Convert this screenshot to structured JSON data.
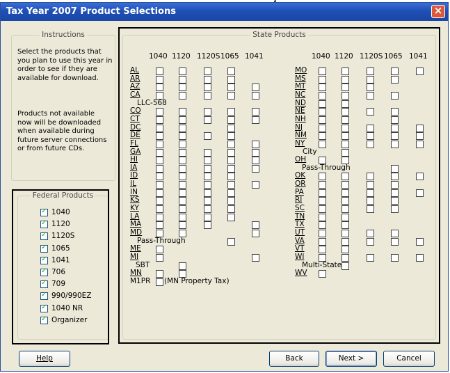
{
  "window": {
    "title": "Tax Year 2007 Product Selections"
  },
  "instructions": {
    "title": "Instructions",
    "para1": [
      "Select the products that",
      "you plan to use this year in",
      "order to see if they are",
      "available for download."
    ],
    "para2": [
      "Products not available",
      "now will be downloaded",
      "when available during",
      "future server connections",
      "or from future CDs."
    ]
  },
  "federal": {
    "title": "Federal Products",
    "items": [
      {
        "label": "1040",
        "checked": true
      },
      {
        "label": "1120",
        "checked": true
      },
      {
        "label": "1120S",
        "checked": true
      },
      {
        "label": "1065",
        "checked": true
      },
      {
        "label": "1041",
        "checked": true
      },
      {
        "label": "706",
        "checked": true
      },
      {
        "label": "709",
        "checked": true
      },
      {
        "label": "990/990EZ",
        "checked": true
      },
      {
        "label": "1040 NR",
        "checked": true
      },
      {
        "label": "Organizer",
        "checked": true
      }
    ]
  },
  "state": {
    "title": "State Products",
    "columns": [
      "1040",
      "1120",
      "1120S",
      "1065",
      "1041"
    ],
    "left": [
      {
        "state": "AL",
        "boxes": [
          1,
          1,
          1,
          1,
          0
        ]
      },
      {
        "state": "AR",
        "boxes": [
          1,
          1,
          1,
          1,
          0
        ]
      },
      {
        "state": "AZ",
        "boxes": [
          1,
          1,
          1,
          1,
          1
        ]
      },
      {
        "state": "CA",
        "boxes": [
          1,
          1,
          1,
          1,
          1
        ]
      },
      {
        "state": "",
        "extra": "LLC-568",
        "boxes": [
          0,
          0,
          0,
          0,
          0
        ]
      },
      {
        "state": "CO",
        "boxes": [
          1,
          1,
          1,
          1,
          1
        ]
      },
      {
        "state": "CT",
        "boxes": [
          1,
          1,
          1,
          1,
          1
        ]
      },
      {
        "state": "DC",
        "boxes": [
          1,
          1,
          0,
          1,
          0
        ]
      },
      {
        "state": "DE",
        "boxes": [
          1,
          1,
          1,
          1,
          0
        ]
      },
      {
        "state": "FL",
        "boxes": [
          1,
          1,
          0,
          1,
          1
        ]
      },
      {
        "state": "GA",
        "boxes": [
          1,
          1,
          1,
          1,
          1
        ]
      },
      {
        "state": "HI",
        "boxes": [
          1,
          1,
          1,
          1,
          1
        ]
      },
      {
        "state": "IA",
        "boxes": [
          1,
          1,
          1,
          1,
          1
        ]
      },
      {
        "state": "ID",
        "boxes": [
          1,
          1,
          1,
          1,
          0
        ]
      },
      {
        "state": "IL",
        "boxes": [
          1,
          1,
          1,
          1,
          1
        ]
      },
      {
        "state": "IN",
        "boxes": [
          1,
          1,
          1,
          1,
          0
        ]
      },
      {
        "state": "KS",
        "boxes": [
          1,
          1,
          1,
          1,
          0
        ]
      },
      {
        "state": "KY",
        "boxes": [
          1,
          1,
          1,
          1,
          0
        ]
      },
      {
        "state": "LA",
        "boxes": [
          1,
          1,
          1,
          1,
          0
        ]
      },
      {
        "state": "MA",
        "boxes": [
          1,
          1,
          1,
          0,
          1
        ]
      },
      {
        "state": "MD",
        "boxes": [
          1,
          1,
          0,
          0,
          1
        ]
      },
      {
        "state": "",
        "extra": "Pass-Through",
        "boxes": [
          0,
          0,
          0,
          1,
          0
        ]
      },
      {
        "state": "ME",
        "boxes": [
          1,
          0,
          0,
          0,
          0
        ]
      },
      {
        "state": "MI",
        "boxes": [
          1,
          0,
          0,
          0,
          1
        ]
      },
      {
        "state": "",
        "extra": "SBT",
        "boxes": [
          0,
          1,
          0,
          0,
          0
        ]
      },
      {
        "state": "MN",
        "boxes": [
          1,
          1,
          0,
          0,
          0
        ]
      },
      {
        "state": "M1PR",
        "plain": true,
        "extra": "(MN Property Tax)",
        "boxes": [
          0,
          0,
          0,
          0,
          0
        ]
      }
    ],
    "right": [
      {
        "state": "MO",
        "boxes": [
          1,
          1,
          1,
          1,
          1
        ]
      },
      {
        "state": "MS",
        "boxes": [
          1,
          1,
          1,
          1,
          0
        ]
      },
      {
        "state": "MT",
        "boxes": [
          1,
          1,
          1,
          0,
          0
        ]
      },
      {
        "state": "NC",
        "boxes": [
          1,
          1,
          1,
          1,
          0
        ]
      },
      {
        "state": "ND",
        "boxes": [
          1,
          1,
          0,
          0,
          0
        ]
      },
      {
        "state": "NE",
        "boxes": [
          1,
          1,
          1,
          1,
          0
        ]
      },
      {
        "state": "NH",
        "boxes": [
          1,
          1,
          0,
          1,
          0
        ]
      },
      {
        "state": "NJ",
        "boxes": [
          1,
          1,
          1,
          1,
          1
        ]
      },
      {
        "state": "NM",
        "boxes": [
          1,
          1,
          1,
          1,
          1
        ]
      },
      {
        "state": "NY",
        "boxes": [
          1,
          1,
          1,
          1,
          1
        ]
      },
      {
        "state": "",
        "extra": "City",
        "boxes": [
          0,
          1,
          0,
          0,
          0
        ]
      },
      {
        "state": "OH",
        "boxes": [
          1,
          1,
          0,
          0,
          0
        ]
      },
      {
        "state": "",
        "extra": "Pass-Through",
        "boxes": [
          0,
          0,
          0,
          1,
          0
        ]
      },
      {
        "state": "OK",
        "boxes": [
          1,
          1,
          1,
          1,
          1
        ]
      },
      {
        "state": "OR",
        "boxes": [
          1,
          1,
          1,
          1,
          0
        ]
      },
      {
        "state": "PA",
        "boxes": [
          1,
          1,
          1,
          1,
          1
        ]
      },
      {
        "state": "RI",
        "boxes": [
          1,
          1,
          1,
          1,
          0
        ]
      },
      {
        "state": "SC",
        "boxes": [
          1,
          1,
          1,
          1,
          0
        ]
      },
      {
        "state": "TN",
        "boxes": [
          1,
          1,
          0,
          0,
          0
        ]
      },
      {
        "state": "TX",
        "boxes": [
          1,
          1,
          0,
          0,
          0
        ]
      },
      {
        "state": "UT",
        "boxes": [
          1,
          1,
          1,
          1,
          0
        ]
      },
      {
        "state": "VA",
        "boxes": [
          1,
          1,
          1,
          1,
          1
        ]
      },
      {
        "state": "VT",
        "boxes": [
          1,
          1,
          0,
          0,
          0
        ]
      },
      {
        "state": "WI",
        "boxes": [
          1,
          1,
          1,
          1,
          1
        ]
      },
      {
        "state": "",
        "extra": "Multi-State",
        "boxes": [
          0,
          1,
          0,
          0,
          0
        ]
      },
      {
        "state": "WV",
        "boxes": [
          1,
          0,
          0,
          0,
          0
        ]
      }
    ]
  },
  "buttons": {
    "help": "Help",
    "back": "Back",
    "next": "Next >",
    "cancel": "Cancel"
  }
}
